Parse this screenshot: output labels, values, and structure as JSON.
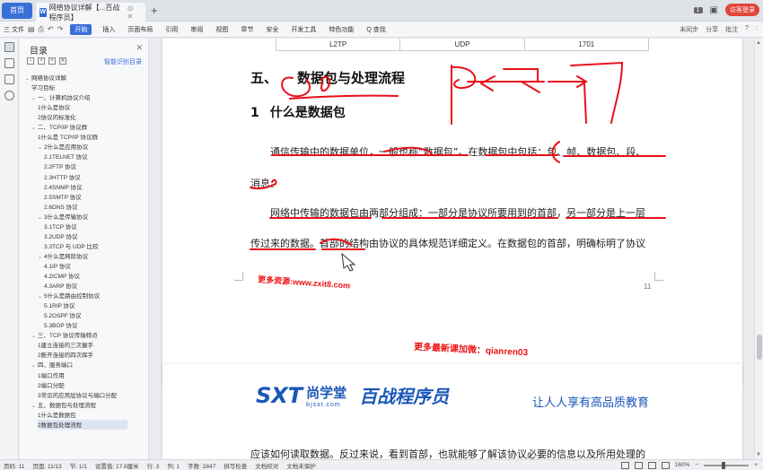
{
  "titlebar": {
    "home_tab": "首页",
    "doc_tab": "网络协议详解【...百战程序员】",
    "tab_badge": "1",
    "login": "访客登录"
  },
  "toolbar": {
    "file": "三 文件",
    "start": "开始",
    "menus": [
      "插入",
      "页面布局",
      "引用",
      "审阅",
      "视图",
      "章节",
      "安全",
      "开发工具",
      "特色功能",
      "Q 查找"
    ],
    "right": [
      "未同步",
      "分享",
      "批注",
      "?",
      ":"
    ]
  },
  "toc": {
    "title": "目录",
    "smart": "智能识别目录",
    "items": [
      {
        "label": "网络协议详解",
        "indent": 0,
        "arrow": "⌄"
      },
      {
        "label": "学习目标",
        "indent": 1,
        "arrow": ""
      },
      {
        "label": "一、计算机协议介绍",
        "indent": 1,
        "arrow": "⌄"
      },
      {
        "label": "1什么是协议",
        "indent": 2,
        "arrow": ""
      },
      {
        "label": "2协议的标准化",
        "indent": 2,
        "arrow": ""
      },
      {
        "label": "二、TCP/IP 协议群",
        "indent": 1,
        "arrow": "⌄"
      },
      {
        "label": "1什么是 TCP/IP 协议群",
        "indent": 2,
        "arrow": ""
      },
      {
        "label": "2什么是应用协议",
        "indent": 2,
        "arrow": "⌄"
      },
      {
        "label": "2.1TELNET 协议",
        "indent": 3,
        "arrow": ""
      },
      {
        "label": "2.2FTP 协议",
        "indent": 3,
        "arrow": ""
      },
      {
        "label": "2.3HTTP 协议",
        "indent": 3,
        "arrow": ""
      },
      {
        "label": "2.4SNMP 协议",
        "indent": 3,
        "arrow": ""
      },
      {
        "label": "2.5SMTP 协议",
        "indent": 3,
        "arrow": ""
      },
      {
        "label": "2.6DNS 协议",
        "indent": 3,
        "arrow": ""
      },
      {
        "label": "3什么是传输协议",
        "indent": 2,
        "arrow": "⌄"
      },
      {
        "label": "3.1TCP 协议",
        "indent": 3,
        "arrow": ""
      },
      {
        "label": "3.2UDP 协议",
        "indent": 3,
        "arrow": ""
      },
      {
        "label": "3.3TCP 与 UDP 比较",
        "indent": 3,
        "arrow": ""
      },
      {
        "label": "4什么是网际协议",
        "indent": 2,
        "arrow": "⌄"
      },
      {
        "label": "4.1IP 协议",
        "indent": 3,
        "arrow": ""
      },
      {
        "label": "4.2ICMP 协议",
        "indent": 3,
        "arrow": ""
      },
      {
        "label": "4.3ARP 协议",
        "indent": 3,
        "arrow": ""
      },
      {
        "label": "5什么是路由控制协议",
        "indent": 2,
        "arrow": "⌄"
      },
      {
        "label": "5.1RIP 协议",
        "indent": 3,
        "arrow": ""
      },
      {
        "label": "5.2OSPF 协议",
        "indent": 3,
        "arrow": ""
      },
      {
        "label": "5.3BGP 协议",
        "indent": 3,
        "arrow": ""
      },
      {
        "label": "三、TCP 协议传输特点",
        "indent": 1,
        "arrow": "⌄"
      },
      {
        "label": "1建立连接的三次握手",
        "indent": 2,
        "arrow": ""
      },
      {
        "label": "2断开连接的四次挥手",
        "indent": 2,
        "arrow": ""
      },
      {
        "label": "四、服务端口",
        "indent": 1,
        "arrow": "⌄"
      },
      {
        "label": "1端口作用",
        "indent": 2,
        "arrow": ""
      },
      {
        "label": "2端口分配",
        "indent": 2,
        "arrow": ""
      },
      {
        "label": "3常见的应用层协议与端口分配",
        "indent": 2,
        "arrow": ""
      },
      {
        "label": "五、数据包与处理流程",
        "indent": 1,
        "arrow": "⌄"
      },
      {
        "label": "1什么是数据包",
        "indent": 2,
        "arrow": ""
      },
      {
        "label": "2数据包处理流程",
        "indent": 2,
        "arrow": "",
        "selected": true
      }
    ]
  },
  "document": {
    "table_row": [
      "L2TP",
      "UDP",
      "1701"
    ],
    "section_num": "五、",
    "section_title": "数据包与处理流程",
    "sub_num": "1",
    "sub_title": "什么是数据包",
    "para1_line1": "通信传输中的数据单位，一般也称“数据包”。在数据包中包括：包、帧、数据包、段、",
    "para1_line2": "消息。",
    "para2_line1": "网络中传输的数据包由两部分组成：一部分是协议所要用到的首部，另一部分是上一层",
    "para2_line2": "传过来的数据。首部的结构由协议的具体规范详细定义。在数据包的首部，明确标明了协议",
    "page_number": "11",
    "watermark1": "更多资源:www.zxit8.com",
    "watermark2": "更多最新课加微：qianren03",
    "logo_sxt": "SXT",
    "logo_cn": "尚学堂",
    "logo_url": "bjsxt.com",
    "logo_bz": "百战程序员",
    "slogan": "让人人享有高品质教育",
    "page2_text": "应该如何读取数据。反过来说，看到首部，也就能够了解该协议必要的信息以及所用处理的"
  },
  "statusbar": {
    "items": [
      "页码: 11",
      "页面: 11/13",
      "节: 1/1",
      "设置值: 17.6厘米",
      "行: 3",
      "列: 1",
      "字数: 2847",
      "拼写检查",
      "文档校对",
      "文档未保护"
    ],
    "zoom": "160%"
  },
  "colors": {
    "accent": "#3a6fd8",
    "ink": "#e8101a",
    "brand": "#1b57b8"
  }
}
